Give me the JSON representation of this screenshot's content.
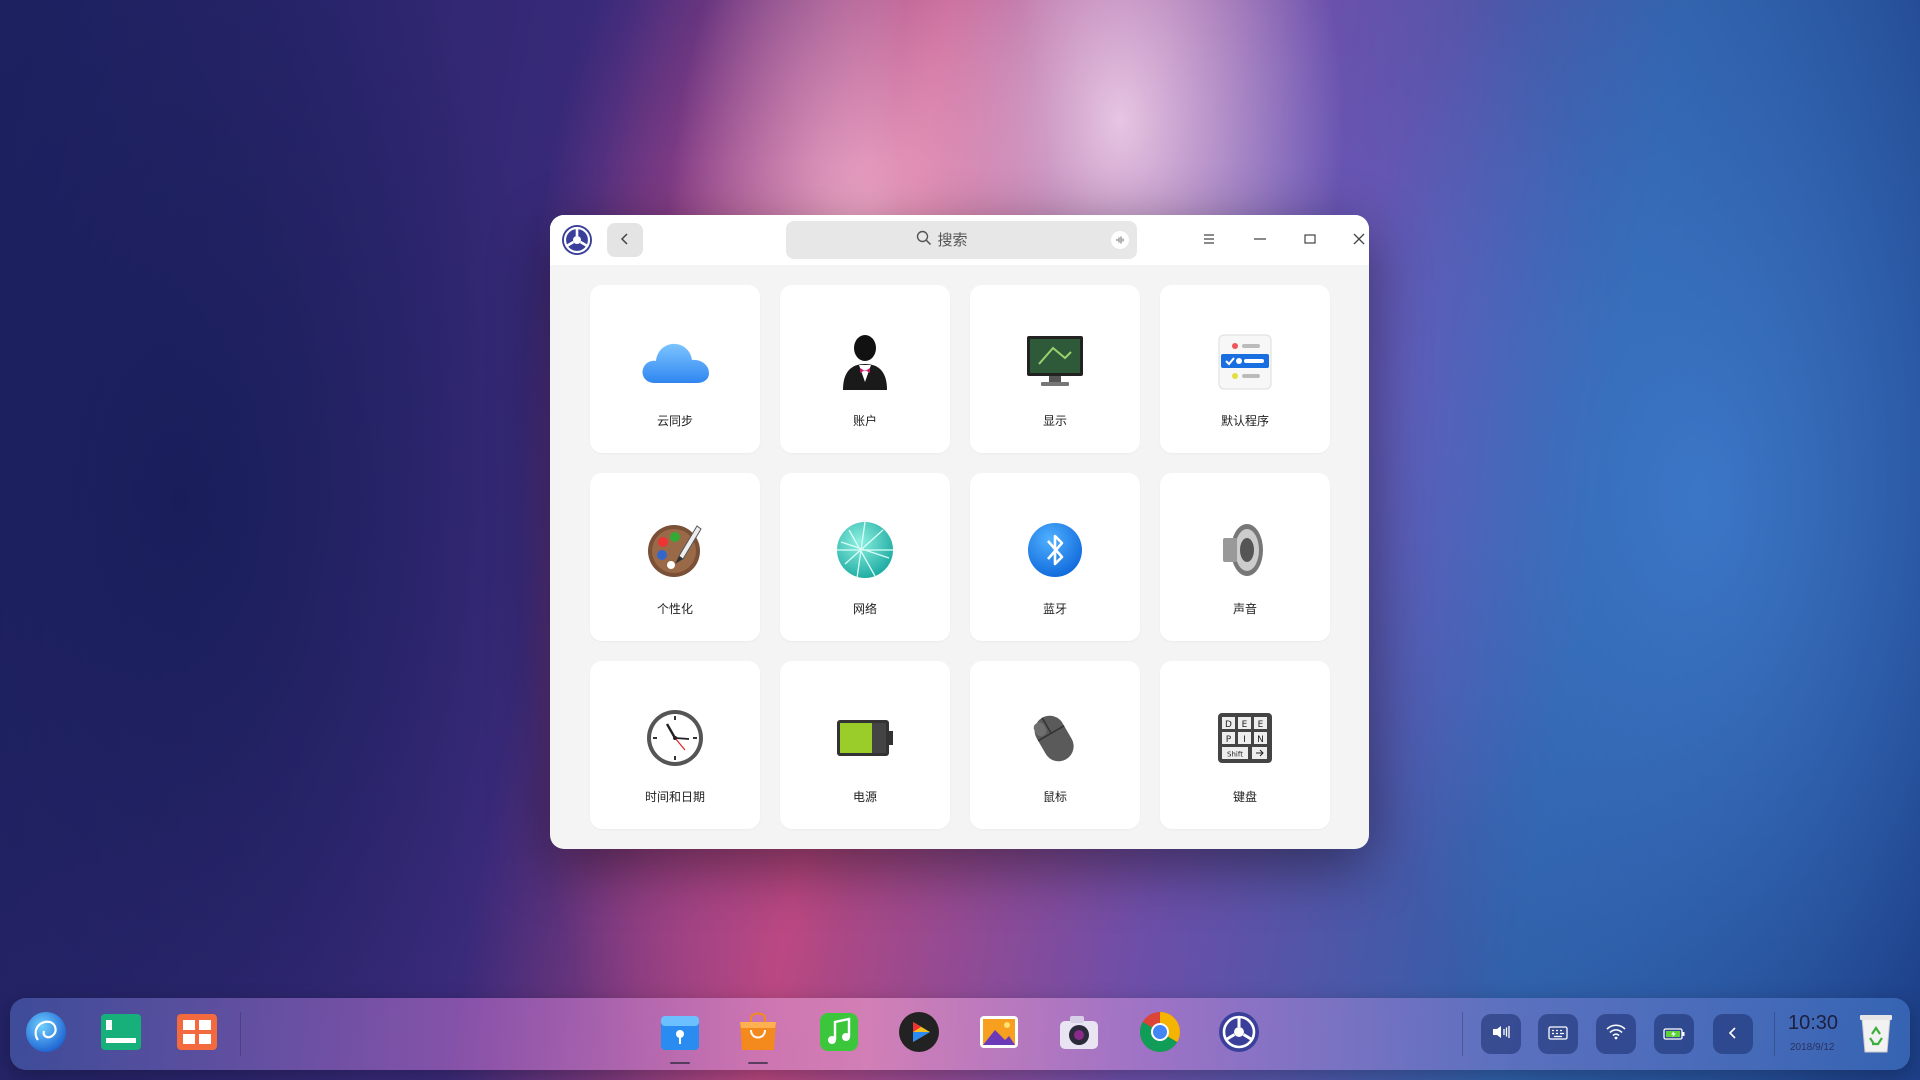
{
  "window": {
    "search_placeholder": "搜索"
  },
  "modules": [
    {
      "label": "云同步",
      "icon": "cloud-icon"
    },
    {
      "label": "账户",
      "icon": "account-icon"
    },
    {
      "label": "显示",
      "icon": "display-icon"
    },
    {
      "label": "默认程序",
      "icon": "default-apps-icon"
    },
    {
      "label": "个性化",
      "icon": "palette-icon"
    },
    {
      "label": "网络",
      "icon": "network-icon"
    },
    {
      "label": "蓝牙",
      "icon": "bluetooth-icon"
    },
    {
      "label": "声音",
      "icon": "speaker-icon"
    },
    {
      "label": "时间和日期",
      "icon": "clock-icon"
    },
    {
      "label": "电源",
      "icon": "battery-icon"
    },
    {
      "label": "鼠标",
      "icon": "mouse-icon"
    },
    {
      "label": "键盘",
      "icon": "keyboard-icon"
    }
  ],
  "keyboard_icon_keys": [
    "D",
    "E",
    "E",
    "P",
    "I",
    "N",
    "Shift"
  ],
  "taskbar": {
    "clock_time": "10:30",
    "clock_date": "2018/9/12"
  }
}
